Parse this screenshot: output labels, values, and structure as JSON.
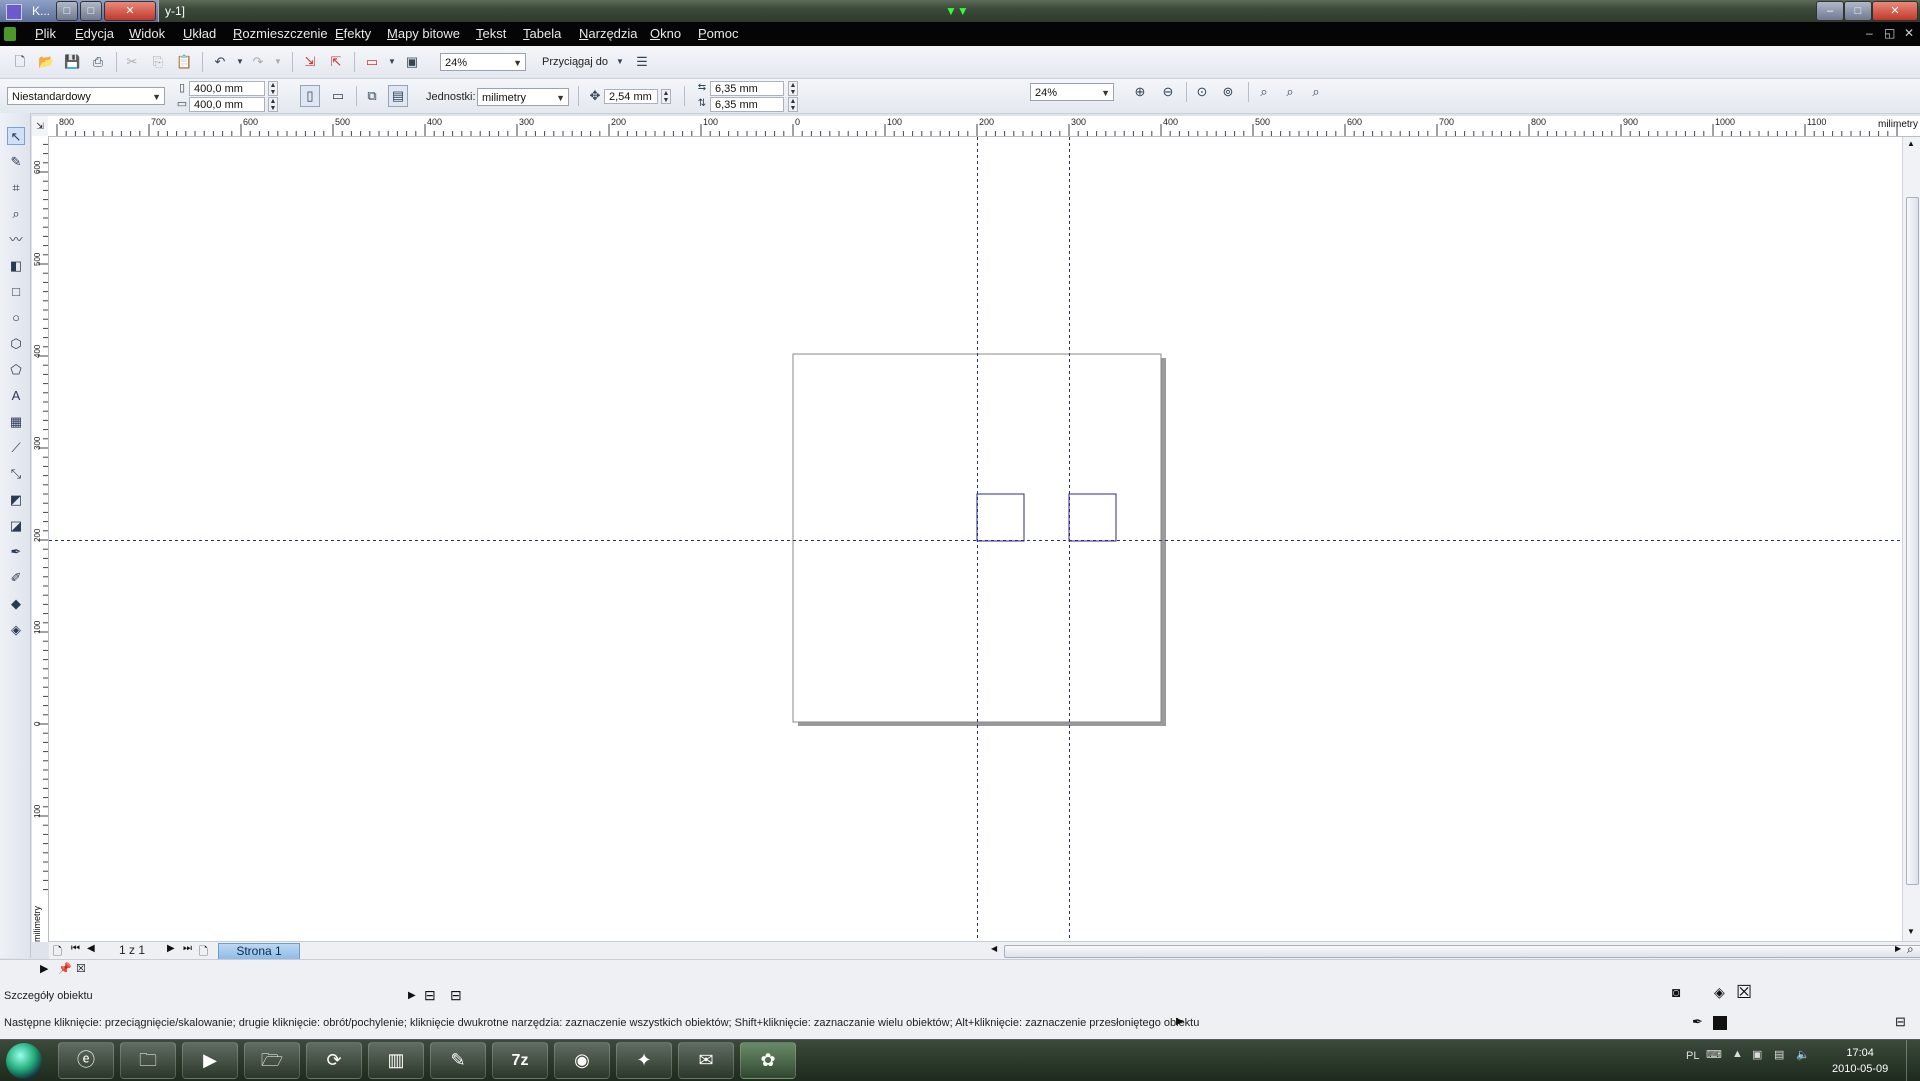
{
  "window": {
    "title_left": "K...",
    "title_right": "y-1]",
    "minimize": "–",
    "maximize": "□",
    "close": "✕"
  },
  "menu": [
    "Plik",
    "Edycja",
    "Widok",
    "Układ",
    "Rozmieszczenie",
    "Efekty",
    "Mapy bitowe",
    "Tekst",
    "Tabela",
    "Narzędzia",
    "Okno",
    "Pomoc"
  ],
  "toolbar1": {
    "zoom": "24%",
    "snap_label": "Przyciągaj do"
  },
  "toolbar2": {
    "paper_preset": "Niestandardowy",
    "width": "400,0 mm",
    "height": "400,0 mm",
    "units_label": "Jednostki:",
    "units": "milimetry",
    "nudge": "2,54 mm",
    "dup_x": "6,35 mm",
    "dup_y": "6,35 mm",
    "zoom2": "24%"
  },
  "ruler": {
    "unit": "milimetry",
    "h_ticks": [
      {
        "label": "800",
        "v": 800
      },
      {
        "label": "700",
        "v": 700
      },
      {
        "label": "600",
        "v": 600
      },
      {
        "label": "500",
        "v": 500
      },
      {
        "label": "400",
        "v": 400
      },
      {
        "label": "300",
        "v": 300
      },
      {
        "label": "200",
        "v": 200
      },
      {
        "label": "100",
        "v": 100
      },
      {
        "label": "0",
        "v": 0
      },
      {
        "label": "100",
        "v": -100
      },
      {
        "label": "200",
        "v": -200
      },
      {
        "label": "300",
        "v": -300
      },
      {
        "label": "400",
        "v": -400
      },
      {
        "label": "500",
        "v": -500
      },
      {
        "label": "600",
        "v": -600
      },
      {
        "label": "700",
        "v": -700
      },
      {
        "label": "800",
        "v": -800
      },
      {
        "label": "900",
        "v": -900
      },
      {
        "label": "1000",
        "v": -1000
      },
      {
        "label": "1100",
        "v": -1100
      }
    ],
    "v_ticks": [
      {
        "label": "600",
        "v": 600
      },
      {
        "label": "500",
        "v": 500
      },
      {
        "label": "400",
        "v": 400
      },
      {
        "label": "300",
        "v": 300
      },
      {
        "label": "200",
        "v": 200
      },
      {
        "label": "100",
        "v": 100
      },
      {
        "label": "0",
        "v": 0
      },
      {
        "label": "100",
        "v": -100
      }
    ],
    "v_unit": "milimetry"
  },
  "document": {
    "page_counter": "1 z 1",
    "page_tab": "Strona 1"
  },
  "status": {
    "object_details": "Szczegóły obiektu",
    "hint": "Następne kliknięcie: przeciągnięcie/skalowanie; drugie kliknięcie: obrót/pochylenie; kliknięcie dwukrotne narzędzia: zaznaczenie wszystkich obiektów; Shift+kliknięcie: zaznaczanie wielu obiektów; Alt+kliknięcie: zaznaczenie przesłoniętego obiektu"
  },
  "taskbar": {
    "lang": "PL",
    "time": "17:04",
    "date": "2010-05-09",
    "apps": [
      "ie",
      "explorer",
      "media",
      "folder",
      "sync",
      "winrar",
      "pen",
      "7z",
      "firefox",
      "acrobat",
      "mail",
      "corel"
    ]
  },
  "colors": {
    "guide": "#2b2b8f",
    "page_border": "#888888",
    "shadow": "#9a9a9a"
  }
}
